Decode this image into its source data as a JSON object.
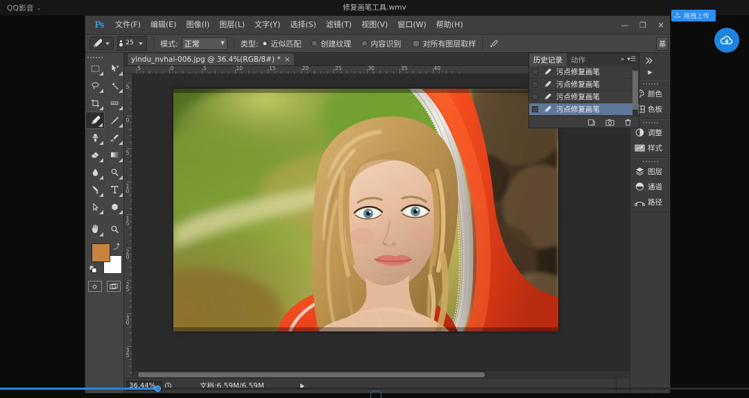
{
  "player": {
    "app_name": "QQ影音",
    "caret": "⌄",
    "video_title": "修复画笔工具.wmv",
    "upload_badge_label": "拖拽上传",
    "cloud_icon": "cloud-download-icon",
    "progress_percent": 21
  },
  "photoshop": {
    "logo": "Ps",
    "menu": [
      {
        "label": "文件(F)",
        "name": "menu-file"
      },
      {
        "label": "编辑(E)",
        "name": "menu-edit"
      },
      {
        "label": "图像(I)",
        "name": "menu-image"
      },
      {
        "label": "图层(L)",
        "name": "menu-layer"
      },
      {
        "label": "文字(Y)",
        "name": "menu-type"
      },
      {
        "label": "选择(S)",
        "name": "menu-select"
      },
      {
        "label": "滤镜(T)",
        "name": "menu-filter"
      },
      {
        "label": "视图(V)",
        "name": "menu-view"
      },
      {
        "label": "窗口(W)",
        "name": "menu-window"
      },
      {
        "label": "帮助(H)",
        "name": "menu-help"
      }
    ],
    "window_controls": {
      "minimize": "—",
      "maximize": "❐",
      "close": "✕"
    },
    "options_bar": {
      "tool_icon": "spot-healing-brush-icon",
      "brush_size": "25",
      "mode_label": "模式:",
      "mode_value": "正常",
      "type_label": "类型:",
      "type_options": [
        {
          "label": "近似匹配",
          "selected": true
        },
        {
          "label": "创建纹理",
          "selected": false
        },
        {
          "label": "内容识别",
          "selected": false
        }
      ],
      "sample_all_layers_label": "对所有图层取样",
      "sample_all_layers_checked": false,
      "pressure_icon": "tablet-pressure-icon",
      "workspace_btn": "基"
    },
    "document": {
      "tab_label": "yindu_nvhai-006.jpg @ 36.4%(RGB/8#) *",
      "tab_close": "×",
      "ruler_h_labels": [
        "5",
        "0",
        "5",
        "10",
        "15",
        "20",
        "25",
        "30",
        "35",
        "40"
      ],
      "ruler_v_labels": [
        "5",
        "0",
        "5",
        "10",
        "15",
        "20",
        "25",
        "30",
        "35"
      ]
    },
    "status_bar": {
      "zoom_value": "36.44%",
      "doc_info": "文档:6.59M/6.59M",
      "play_icon": "play-triangle-icon"
    },
    "history_panel": {
      "tabs": [
        {
          "label": "历史记录",
          "active": true
        },
        {
          "label": "动作",
          "active": false
        }
      ],
      "collapse_icon": "double-chevron-right-icon",
      "menu_icon": "panel-menu-icon",
      "items": [
        {
          "label": "污点修复画笔",
          "selected": false
        },
        {
          "label": "污点修复画笔",
          "selected": false
        },
        {
          "label": "污点修复画笔",
          "selected": false
        },
        {
          "label": "污点修复画笔",
          "selected": true
        }
      ],
      "footer_icons": [
        "new-document-from-state-icon",
        "new-snapshot-icon",
        "delete-icon"
      ]
    },
    "right_dock": {
      "groups": [
        {
          "items": [
            {
              "label": "颜色",
              "icon": "color-palette-icon"
            },
            {
              "label": "色板",
              "icon": "swatches-icon"
            }
          ]
        },
        {
          "items": [
            {
              "label": "调整",
              "icon": "adjustments-icon"
            },
            {
              "label": "样式",
              "icon": "styles-icon"
            }
          ]
        },
        {
          "items": [
            {
              "label": "图层",
              "icon": "layers-icon"
            },
            {
              "label": "通道",
              "icon": "channels-icon"
            },
            {
              "label": "路径",
              "icon": "paths-icon"
            }
          ]
        }
      ]
    },
    "toolbar": {
      "tools": [
        {
          "name": "marquee-tool",
          "selected": false
        },
        {
          "name": "move-tool",
          "selected": false
        },
        {
          "name": "lasso-tool",
          "selected": false
        },
        {
          "name": "magic-wand-tool",
          "selected": false
        },
        {
          "name": "crop-tool",
          "selected": false
        },
        {
          "name": "eyedropper-tool",
          "selected": false
        },
        {
          "name": "spot-healing-brush-tool",
          "selected": true
        },
        {
          "name": "brush-tool",
          "selected": false
        },
        {
          "name": "clone-stamp-tool",
          "selected": false
        },
        {
          "name": "history-brush-tool",
          "selected": false
        },
        {
          "name": "eraser-tool",
          "selected": false
        },
        {
          "name": "gradient-tool",
          "selected": false
        },
        {
          "name": "blur-tool",
          "selected": false
        },
        {
          "name": "dodge-tool",
          "selected": false
        },
        {
          "name": "pen-tool",
          "selected": false
        },
        {
          "name": "type-tool",
          "selected": false
        },
        {
          "name": "path-selection-tool",
          "selected": false
        },
        {
          "name": "shape-tool",
          "selected": false
        },
        {
          "name": "hand-tool",
          "selected": false
        },
        {
          "name": "zoom-tool",
          "selected": false
        }
      ],
      "foreground_color": "#c8843c",
      "background_color": "#ffffff"
    }
  },
  "colors": {
    "accent_blue": "#1f8ae0",
    "ps_chrome": "#3f3f3f",
    "canvas_bg": "#2b2b2b",
    "history_selected": "#5f7899",
    "sari_orange": "#e8421a",
    "foliage_green": "#7d9b33"
  }
}
